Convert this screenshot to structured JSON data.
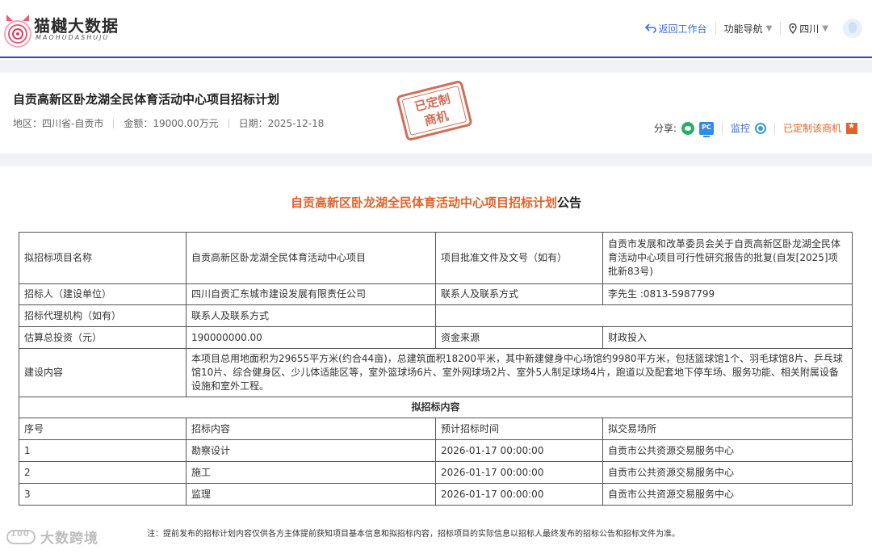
{
  "brand": {
    "name": "猫樾大数据",
    "sub": "MAOHUDASHUJU"
  },
  "nav": {
    "back": "返回工作台",
    "function_nav": "功能导航",
    "region": "四川"
  },
  "project": {
    "title": "自贡高新区卧龙湖全民体育活动中心项目招标计划",
    "region_label": "地区：",
    "region": "四川省-自贡市",
    "amount_label": "金额：",
    "amount": "19000.00万元",
    "date_label": "日期：",
    "date": "2025-12-18",
    "stamp_line1": "已定制",
    "stamp_line2": "商机"
  },
  "actions": {
    "share_label": "分享:",
    "pc_text": "PC",
    "monitor": "监控",
    "customized": "已定制该商机"
  },
  "announcement": {
    "title_main": "自贡高新区卧龙湖全民体育活动中心项目招标计划",
    "title_tail": "公告"
  },
  "table": {
    "row1": {
      "k1": "拟招标项目名称",
      "v1": "自贡高新区卧龙湖全民体育活动中心项目",
      "k2": "项目批准文件及文号（如有）",
      "v2": "自贡市发展和改革委员会关于自贡高新区卧龙湖全民体育活动中心项目可行性研究报告的批复(自发[2025]项批新83号)"
    },
    "row2": {
      "k1": "招标人（建设单位）",
      "v1": "四川自贡汇东城市建设发展有限责任公司",
      "k2": "联系人及联系方式",
      "v2": "李先生 :0813-5987799"
    },
    "row3": {
      "k1": "招标代理机构（如有）",
      "v1": "联系人及联系方式",
      "v2": ""
    },
    "row4": {
      "k1": "估算总投资（元）",
      "v1": "190000000.00",
      "k2": "资金来源",
      "v2": "财政投入"
    },
    "row5": {
      "k1": "建设内容",
      "v1": "本项目总用地面积为29655平方米(约合44亩)，总建筑面积18200平米，其中新建健身中心场馆约9980平方米，包括篮球馆1个、羽毛球馆8片、乒乓球馆10片、综合健身区、少儿体适能区等，室外篮球场6片、室外网球场2片、室外5人制足球场4片，跑道以及配套地下停车场、服务功能、相关附属设备设施和室外工程。"
    },
    "section_head": "拟招标内容",
    "columns": [
      "序号",
      "招标内容",
      "预计招标时间",
      "拟交易场所"
    ],
    "items": [
      {
        "no": "1",
        "content": "勘察设计",
        "time": "2026-01-17 00:00:00",
        "place": "自贡市公共资源交易服务中心"
      },
      {
        "no": "2",
        "content": "施工",
        "time": "2026-01-17 00:00:00",
        "place": "自贡市公共资源交易服务中心"
      },
      {
        "no": "3",
        "content": "监理",
        "time": "2026-01-17 00:00:00",
        "place": "自贡市公共资源交易服务中心"
      }
    ]
  },
  "note": "注：提前发布的招标计划内容仅供各方主体提前获知项目基本信息和拟招标内容，招标项目的实际信息以招标人最终发布的招标公告和招标文件为准。",
  "watermark": "大数跨境",
  "colors": {
    "accent": "#e0632a",
    "link": "#3a6ad8",
    "nav_border": "#2b4aa8"
  }
}
